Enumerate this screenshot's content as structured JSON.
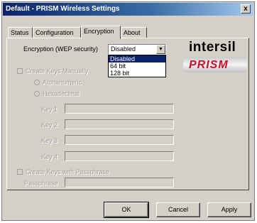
{
  "window": {
    "title": "Default - PRISM Wireless Settings",
    "close_glyph": "x"
  },
  "tabs": [
    {
      "label": "Status"
    },
    {
      "label": "Configuration"
    },
    {
      "label": "Encryption"
    },
    {
      "label": "About"
    }
  ],
  "active_tab": "Encryption",
  "encryption": {
    "label": "Encryption (WEP security)",
    "selected": "Disabled",
    "options": [
      "Disabled",
      "64 bit",
      "128 bit"
    ],
    "highlighted_option": "Disabled"
  },
  "create_keys_manually": {
    "label": "Create Keys Manually",
    "alphanumeric_label": "Alphanumeric",
    "hexadecimal_label": "Hexadecimal",
    "keys": [
      {
        "label": "Key 1",
        "value": ""
      },
      {
        "label": "Key 2",
        "value": ""
      },
      {
        "label": "Key 3",
        "value": ""
      },
      {
        "label": "Key 4",
        "value": ""
      }
    ]
  },
  "create_keys_passphrase": {
    "label": "Create Keys with Passphrase",
    "passphrase_label": "Passphrase",
    "passphrase_value": ""
  },
  "logos": {
    "top": "intersil",
    "bottom": "PRISM"
  },
  "buttons": {
    "ok": "OK",
    "cancel": "Cancel",
    "apply": "Apply"
  }
}
